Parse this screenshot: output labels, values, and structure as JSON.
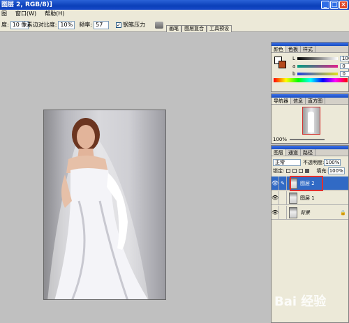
{
  "window": {
    "title": "图层 2, RGB/8)]",
    "min": "_",
    "max": "□",
    "close": "×"
  },
  "menu": [
    "图",
    "窗口(W)",
    "帮助(H)"
  ],
  "options": {
    "hardness_label": "度:",
    "hardness_value": "10 像素",
    "edge_contrast_label": "边对比度:",
    "edge_contrast_value": "10%",
    "frequency_label": "频率:",
    "frequency_value": "57",
    "pen_pressure_label": "钢笔压力",
    "pen_pressure_checked": "✓"
  },
  "wells": [
    "画笔",
    "图层复合",
    "工具预设"
  ],
  "color_panel": {
    "tabs": [
      "颜色",
      "色板",
      "样式"
    ],
    "sliders": [
      {
        "label": "L",
        "value": "100",
        "color_from": "#000000",
        "color_to": "#ffffff"
      },
      {
        "label": "a",
        "value": "0",
        "color_from": "#00a080",
        "color_to": "#e0208c"
      },
      {
        "label": "b",
        "value": "0",
        "color_from": "#2040e0",
        "color_to": "#e0e020"
      }
    ],
    "foreground": "#ffffff",
    "background": "#b5491c"
  },
  "navigator_panel": {
    "tabs": [
      "导航器",
      "信息",
      "直方图"
    ],
    "zoom": "100%"
  },
  "layers_panel": {
    "tabs": [
      "图层",
      "通道",
      "路径"
    ],
    "blend_mode": "正常",
    "opacity_label": "不透明度:",
    "opacity_value": "100%",
    "lock_label": "锁定:",
    "fill_label": "填充:",
    "fill_value": "100%",
    "layers": [
      {
        "name": "图层 2",
        "selected": true
      },
      {
        "name": "图层 1",
        "selected": false
      },
      {
        "name": "背景",
        "selected": false
      }
    ],
    "eye_glyph": "👁",
    "brush_glyph": "✎",
    "lock_glyph": "🔒"
  },
  "watermark": "Bai 经验"
}
